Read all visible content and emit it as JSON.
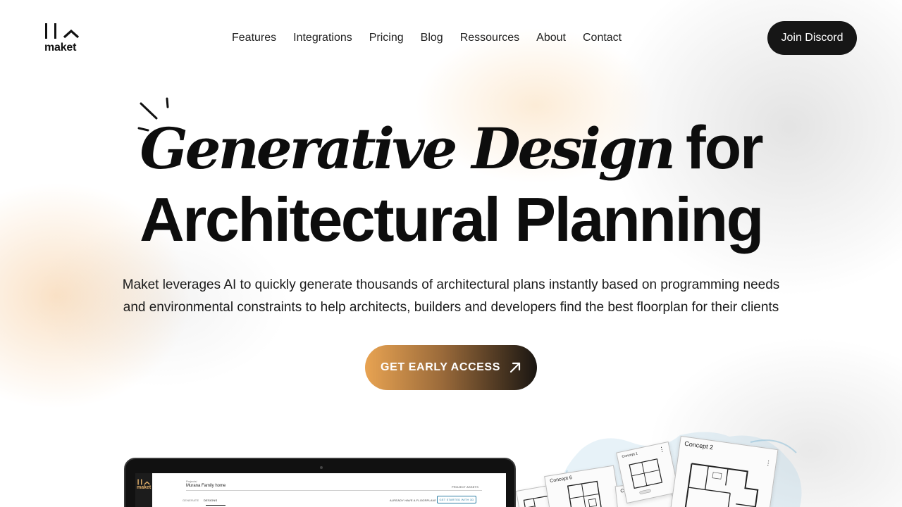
{
  "brand": {
    "name": "maket"
  },
  "nav": {
    "items": [
      {
        "label": "Features"
      },
      {
        "label": "Integrations"
      },
      {
        "label": "Pricing"
      },
      {
        "label": "Blog"
      },
      {
        "label": "Ressources"
      },
      {
        "label": "About"
      },
      {
        "label": "Contact"
      }
    ],
    "cta_label": "Join Discord"
  },
  "hero": {
    "title_italic": "Generative Design",
    "title_for": "for",
    "title_line2": "Architectural Planning",
    "subtitle_line1": "Maket leverages AI to quickly generate thousands of architectural plans instantly based on programming needs",
    "subtitle_line2": "and environmental constraints to help architects, builders and developers find the best floorplan for their clients",
    "cta_label": "GET EARLY ACCESS",
    "cta_icon": "arrow-up-right-icon"
  },
  "app_preview": {
    "brand": "maket",
    "projects_label": "Projects/",
    "project_name": "Murana Family home",
    "project_assets": "PROJECT ASSETS",
    "tabs": [
      {
        "label": "GENERATE"
      },
      {
        "label": "DESIGNS"
      }
    ],
    "active_tab": "DESIGNS",
    "already_text": "ALREADY HAVE A FLOORPLAN?",
    "start_3d_label": "GET STARTED WITH 3D"
  },
  "concept_cards": [
    {
      "title": "Concept 2"
    },
    {
      "title": "Concept 6"
    },
    {
      "title": "Concept 1"
    },
    {
      "title": "Concept 4"
    }
  ],
  "colors": {
    "cta_gradient_start": "#e8a352",
    "cta_gradient_end": "#1a1612",
    "discord_bg": "#161616",
    "app_brand_accent": "#e6b26c",
    "app_button_blue": "#2e7fa5"
  }
}
